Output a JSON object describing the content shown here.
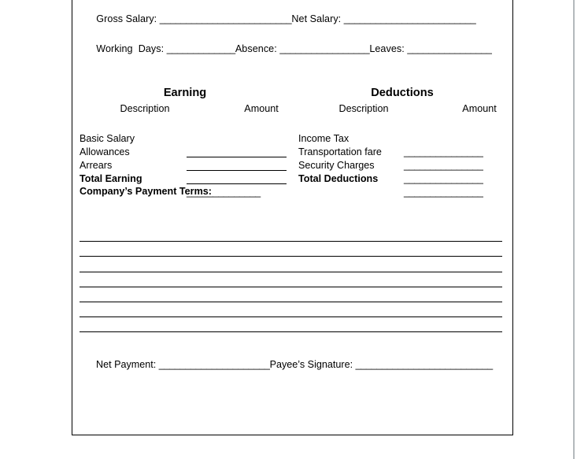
{
  "document": {
    "type": "salary-slip-form",
    "border_color": "#000000",
    "background": "#ffffff",
    "page_edge_color": "#b4b9bc"
  },
  "summary_fields": {
    "row1": {
      "gross_salary_label": "Gross Salary: ",
      "gross_salary_value": "_________________________",
      "net_salary_label": "Net Salary: ",
      "net_salary_value": "_________________________"
    },
    "row2": {
      "working_days_label": "Working  Days: ",
      "working_days_value": "_____________",
      "absence_label": "Absence: ",
      "absence_value": "_________________",
      "leaves_label": "Leaves: ",
      "leaves_value": "________________"
    }
  },
  "earning": {
    "heading": "Earning",
    "columns": {
      "description": "Description",
      "amount": "Amount"
    },
    "rows": [
      {
        "description": "Basic Salary",
        "amount": "",
        "bold": false,
        "amount_style": "rule"
      },
      {
        "description": "Allowances",
        "amount": "",
        "bold": false,
        "amount_style": "rule"
      },
      {
        "description": "Arrears",
        "amount": "",
        "bold": false,
        "amount_style": "rule"
      },
      {
        "description": "Total Earning",
        "amount": "______________",
        "bold": true,
        "amount_style": "dashes"
      }
    ]
  },
  "deductions": {
    "heading": "Deductions",
    "columns": {
      "description": "Description",
      "amount": "Amount"
    },
    "rows": [
      {
        "description": "Income Tax",
        "amount": "_______________",
        "bold": false,
        "amount_style": "dashes"
      },
      {
        "description": "Transportation fare",
        "amount": "_______________",
        "bold": false,
        "amount_style": "dashes"
      },
      {
        "description": "Security Charges",
        "amount": "_______________",
        "bold": false,
        "amount_style": "dashes"
      },
      {
        "description": "Total Deductions",
        "amount": "_______________",
        "bold": true,
        "amount_style": "dashes"
      }
    ]
  },
  "payment_terms": {
    "label": "Company’s Payment Terms:",
    "blank_line_count": 7
  },
  "footer": {
    "net_payment_label": "Net Payment: ",
    "net_payment_value": "_____________________",
    "payee_signature_label": "Payee’s Signature: ",
    "payee_signature_value": "__________________________"
  }
}
